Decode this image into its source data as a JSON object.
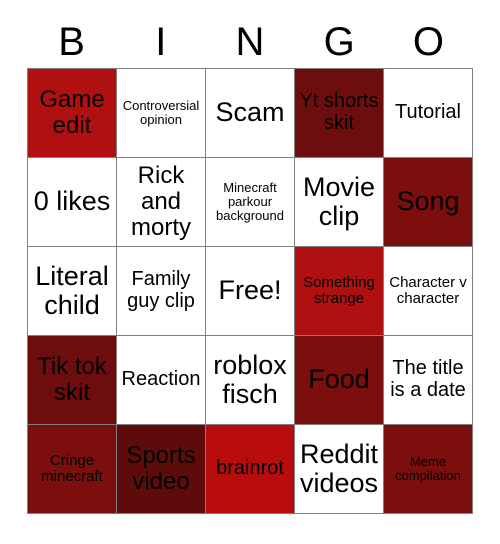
{
  "card": {
    "title": "BINGO",
    "header_letters": [
      "B",
      "I",
      "N",
      "G",
      "O"
    ],
    "colors": {
      "red": "#b11010",
      "dark_maroon": "#6e0d0d",
      "mid_maroon": "#7d0e0e",
      "bright_red": "#b90d0d",
      "deep_maroon": "#5e0b0b",
      "unmarked": "#ffffff",
      "border": "#808080",
      "text": "#000000"
    },
    "grid_size": "5x5",
    "free_space": "Free!",
    "cells": [
      {
        "label": "Game edit",
        "mark": "red",
        "size": "lg"
      },
      {
        "label": "Controversial opinion",
        "mark": "none",
        "size": "xs"
      },
      {
        "label": "Scam",
        "mark": "none",
        "size": "xl"
      },
      {
        "label": "Yt shorts skit",
        "mark": "dark",
        "size": "md"
      },
      {
        "label": "Tutorial",
        "mark": "none",
        "size": "md"
      },
      {
        "label": "0 likes",
        "mark": "none",
        "size": "xl"
      },
      {
        "label": "Rick and morty",
        "mark": "none",
        "size": "lg"
      },
      {
        "label": "Minecraft parkour background",
        "mark": "none",
        "size": "xs"
      },
      {
        "label": "Movie clip",
        "mark": "none",
        "size": "xl"
      },
      {
        "label": "Song",
        "mark": "mid",
        "size": "xl"
      },
      {
        "label": "Literal child",
        "mark": "none",
        "size": "xl"
      },
      {
        "label": "Family guy clip",
        "mark": "none",
        "size": "md"
      },
      {
        "label": "Free!",
        "mark": "none",
        "size": "xl"
      },
      {
        "label": "Something strange",
        "mark": "red",
        "size": "sm"
      },
      {
        "label": "Character v character",
        "mark": "none",
        "size": "sm"
      },
      {
        "label": "Tik tok skit",
        "mark": "dark",
        "size": "lg"
      },
      {
        "label": "Reaction",
        "mark": "none",
        "size": "md"
      },
      {
        "label": "roblox fisch",
        "mark": "none",
        "size": "xl"
      },
      {
        "label": "Food",
        "mark": "mid",
        "size": "xl"
      },
      {
        "label": "The title is a date",
        "mark": "none",
        "size": "md"
      },
      {
        "label": "Cringe minecraft",
        "mark": "mid",
        "size": "sm"
      },
      {
        "label": "Sports video",
        "mark": "deep",
        "size": "lg"
      },
      {
        "label": "brainrot",
        "mark": "bright",
        "size": "md"
      },
      {
        "label": "Reddit videos",
        "mark": "none",
        "size": "xl"
      },
      {
        "label": "Meme compilation",
        "mark": "mid",
        "size": "xs"
      }
    ]
  }
}
